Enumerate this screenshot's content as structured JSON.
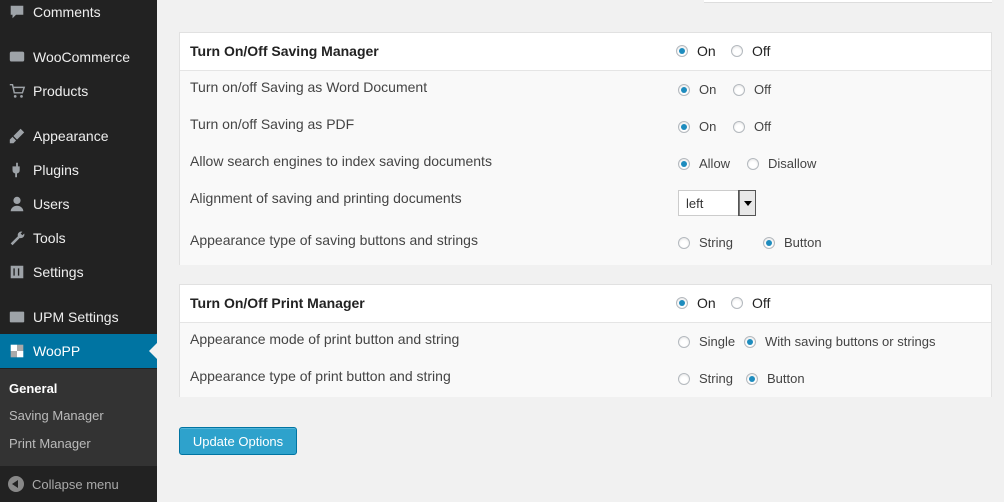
{
  "sidebar": {
    "items": [
      {
        "label": "Comments",
        "icon": "comment-icon"
      },
      {
        "label": "WooCommerce",
        "icon": "woocommerce-icon"
      },
      {
        "label": "Products",
        "icon": "cart-icon"
      },
      {
        "label": "Appearance",
        "icon": "brush-icon"
      },
      {
        "label": "Plugins",
        "icon": "plug-icon"
      },
      {
        "label": "Users",
        "icon": "user-icon"
      },
      {
        "label": "Tools",
        "icon": "wrench-icon"
      },
      {
        "label": "Settings",
        "icon": "sliders-icon"
      },
      {
        "label": "UPM Settings",
        "icon": "pp-icon"
      },
      {
        "label": "WooPP",
        "icon": "woopp-icon"
      }
    ],
    "submenu": [
      "General",
      "Saving Manager",
      "Print Manager"
    ],
    "collapse": "Collapse menu"
  },
  "saving": {
    "title": "Turn On/Off Saving Manager",
    "head_on": "On",
    "head_off": "Off",
    "rows": [
      {
        "label": "Turn on/off Saving as Word Document",
        "opt1": "On",
        "opt2": "Off"
      },
      {
        "label": "Turn on/off Saving as PDF",
        "opt1": "On",
        "opt2": "Off"
      },
      {
        "label": "Allow search engines to index saving documents",
        "opt1": "Allow",
        "opt2": "Disallow"
      },
      {
        "label": "Alignment of saving and printing documents",
        "select": "left"
      },
      {
        "label": "Appearance type of saving buttons and strings",
        "opt1": "String",
        "opt2": "Button"
      }
    ]
  },
  "print": {
    "title": "Turn On/Off Print Manager",
    "head_on": "On",
    "head_off": "Off",
    "rows": [
      {
        "label": "Appearance mode of print button and string",
        "opt1": "Single",
        "opt2": "With saving buttons or strings"
      },
      {
        "label": "Appearance type of print button and string",
        "opt1": "String",
        "opt2": "Button"
      }
    ]
  },
  "update_label": "Update Options",
  "colors": {
    "accent": "#0074a2",
    "button": "#2ea2cc",
    "sidebar": "#222222"
  }
}
